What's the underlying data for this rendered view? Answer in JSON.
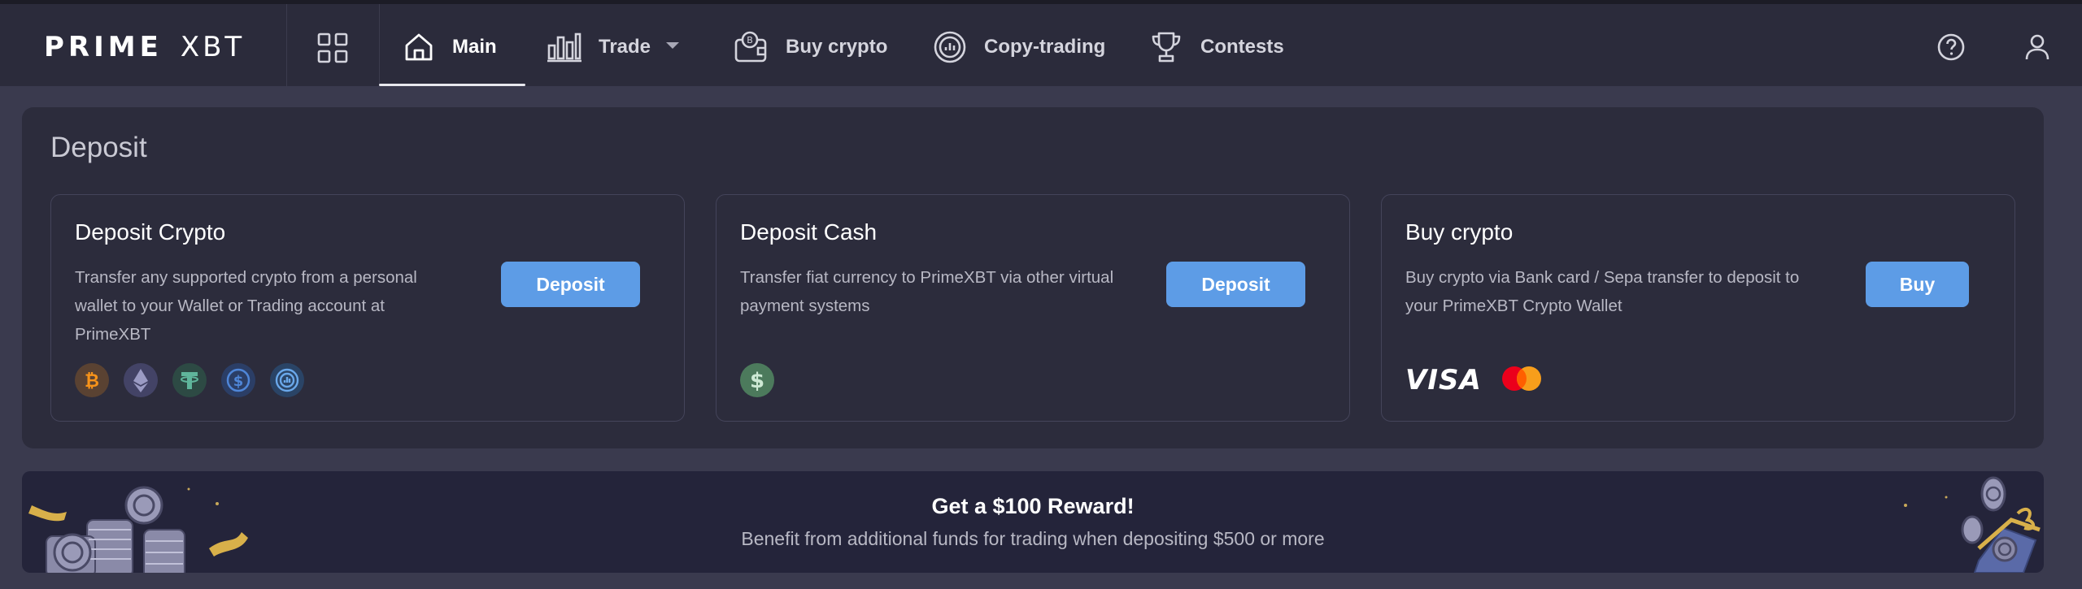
{
  "header": {
    "logo_prime": "PRIME",
    "logo_xbt": "XBT",
    "nav": [
      {
        "label": "Main",
        "icon": "home-icon",
        "active": true
      },
      {
        "label": "Trade",
        "icon": "bar-chart-icon",
        "dropdown": true
      },
      {
        "label": "Buy crypto",
        "icon": "wallet-coin-icon"
      },
      {
        "label": "Copy-trading",
        "icon": "copy-trading-icon"
      },
      {
        "label": "Contests",
        "icon": "trophy-icon"
      }
    ],
    "right_icons": [
      "help-icon",
      "user-icon"
    ]
  },
  "deposit": {
    "title": "Deposit",
    "cards": [
      {
        "title": "Deposit Crypto",
        "desc_lines": [
          "Transfer any supported crypto from a personal",
          "wallet to your Wallet or Trading account at",
          "PrimeXBT"
        ],
        "button": "Deposit",
        "coins": [
          "bitcoin-icon",
          "ethereum-icon",
          "tether-icon",
          "usdc-icon",
          "copy-coin-icon"
        ]
      },
      {
        "title": "Deposit Cash",
        "desc_lines": [
          "Transfer fiat currency to PrimeXBT via other virtual",
          "payment systems"
        ],
        "button": "Deposit",
        "coins": [
          "dollar-icon"
        ]
      },
      {
        "title": "Buy crypto",
        "desc_lines": [
          "Buy crypto via Bank card / Sepa transfer to deposit to",
          "your PrimeXBT Crypto Wallet"
        ],
        "button": "Buy",
        "payment_logos": {
          "visa": "VISA",
          "mastercard": "mastercard-icon"
        }
      }
    ]
  },
  "reward": {
    "title": "Get a $100 Reward!",
    "subtitle": "Benefit from additional funds for trading when depositing $500 or more"
  },
  "colors": {
    "accent": "#5d9ce6",
    "header_bg": "#2b2b3b",
    "page_bg": "#3a3a4e",
    "panel_bg": "#2c2c3c"
  }
}
